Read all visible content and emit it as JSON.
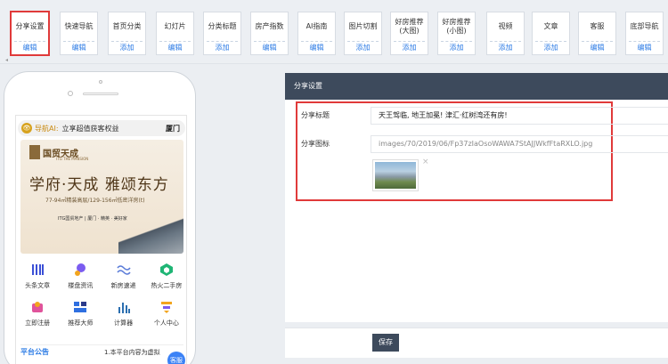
{
  "toolbar": {
    "modules": [
      {
        "name": "分享设置",
        "action": "编辑"
      },
      {
        "name": "快速导航",
        "action": "编辑"
      },
      {
        "name": "首页分类",
        "action": "添加"
      },
      {
        "name": "幻灯片",
        "action": "编辑"
      },
      {
        "name": "分类标题",
        "action": "添加"
      },
      {
        "name": "房产指数",
        "action": "编辑"
      },
      {
        "name": "AI指南",
        "action": "编辑"
      },
      {
        "name": "图片切割",
        "action": "添加"
      },
      {
        "name": "好房推荐(大图)",
        "action": "添加"
      },
      {
        "name": "好房推荐(小图)",
        "action": "添加"
      },
      {
        "name": "视频",
        "action": "添加"
      },
      {
        "name": "文章",
        "action": "添加"
      },
      {
        "name": "客服",
        "action": "编辑"
      },
      {
        "name": "底部导航",
        "action": "编辑"
      }
    ]
  },
  "preview": {
    "topbar": {
      "nav_icon": "👁",
      "nav_label": "导航AI:",
      "nav_text": "立享超值获客权益",
      "city": "厦门"
    },
    "banner": {
      "logo": "国贸天成",
      "logo_sub": "ITG THE MANSION",
      "headline": "学府·天成  雅颂东方",
      "subline": "77-94㎡精装高层/129-156㎡低密洋房(t)",
      "brand": "ITG国贸地产 | 厦门 · 精英 · 美好家"
    },
    "grid": [
      [
        {
          "label": "头条文章",
          "icon": "bars-icon",
          "color": "#3b4fd6"
        },
        {
          "label": "楼盘资讯",
          "icon": "bubbles-icon",
          "color": "#7b5cf0"
        },
        {
          "label": "新房速递",
          "icon": "wave-icon",
          "color": "#5a7bd8"
        },
        {
          "label": "热火二手房",
          "icon": "hexagon-icon",
          "color": "#1fb575"
        }
      ],
      [
        {
          "label": "立即注册",
          "icon": "register-icon",
          "color": "#e0539b"
        },
        {
          "label": "推荐大师",
          "icon": "grid-icon",
          "color": "#2f6fe0"
        },
        {
          "label": "计算器",
          "icon": "chart-icon",
          "color": "#2c6fb0"
        },
        {
          "label": "个人中心",
          "icon": "funnel-icon",
          "color": "#f2a51e"
        }
      ]
    ],
    "notice": {
      "label": "平台公告",
      "text": "1.本平台内容为虚拟",
      "kefu": "客服"
    }
  },
  "panel": {
    "title": "分享设置",
    "share_title_label": "分享标题",
    "share_title_value": "天王驾临, 地王加冕! 津汇·红树湾还有房!",
    "share_icon_label": "分享图标",
    "share_icon_path": "images/70/2019/06/Fp37zIaOsoWAWA7StAJJWkfFtaRXLO.jpg",
    "close_glyph": "×",
    "save_label": "保存"
  },
  "colors": {
    "accent": "#2c7be5",
    "highlight": "#e03a3a",
    "header": "#3d4a5c"
  }
}
